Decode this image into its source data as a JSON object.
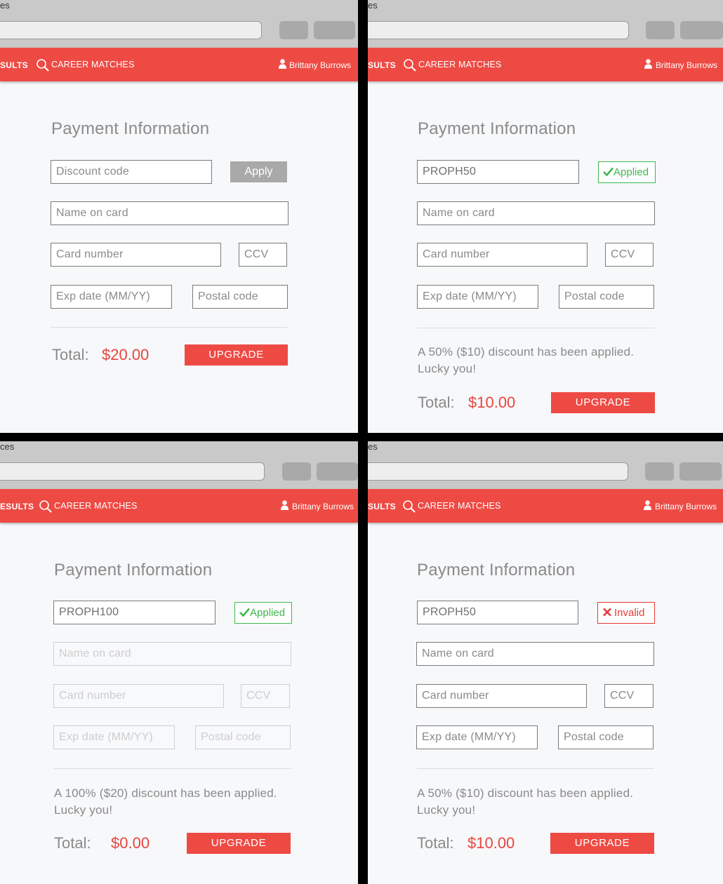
{
  "colors": {
    "accent": "#ee4a44",
    "success": "#3fb84d",
    "error": "#e53935",
    "price": "#e8453e"
  },
  "panels": [
    {
      "tab_fragment": "es",
      "nav": {
        "results": "SULTS",
        "career_matches": "CAREER MATCHES",
        "user": "Brittany Burrows"
      },
      "title": "Payment Information",
      "discount": {
        "placeholder": "Discount code",
        "value": "",
        "button": "Apply"
      },
      "name_on_card": "Name on card",
      "card_number": "Card number",
      "ccv": "CCV",
      "exp_date": "Exp date (MM/YY)",
      "postal_code": "Postal code",
      "message": "",
      "total_label": "Total:",
      "total_value": "$20.00",
      "upgrade": "UPGRADE"
    },
    {
      "tab_fragment": "es",
      "nav": {
        "results": "SULTS",
        "career_matches": "CAREER MATCHES",
        "user": "Brittany Burrows"
      },
      "title": "Payment Information",
      "discount": {
        "value": "PROPH50",
        "status": "Applied",
        "status_icon": "checkmark-icon"
      },
      "name_on_card": "Name on card",
      "card_number": "Card number",
      "ccv": "CCV",
      "exp_date": "Exp date (MM/YY)",
      "postal_code": "Postal code",
      "message_line1": "A 50% ($10) discount has been applied.",
      "message_line2": "Lucky you!",
      "total_label": "Total:",
      "total_value": "$10.00",
      "upgrade": "UPGRADE"
    },
    {
      "tab_fragment": "ces",
      "nav": {
        "results": "ESULTS",
        "career_matches": "CAREER MATCHES",
        "user": "Brittany Burrows"
      },
      "title": "Payment Information",
      "discount": {
        "value": "PROPH100",
        "status": "Applied",
        "status_icon": "checkmark-icon"
      },
      "name_on_card": "Name on card",
      "card_number": "Card number",
      "ccv": "CCV",
      "exp_date": "Exp date (MM/YY)",
      "postal_code": "Postal code",
      "message_line1": "A 100% ($20) discount has been applied.",
      "message_line2": "Lucky you!",
      "total_label": "Total:",
      "total_value": "$0.00",
      "upgrade": "UPGRADE"
    },
    {
      "tab_fragment": "es",
      "nav": {
        "results": "SULTS",
        "career_matches": "CAREER MATCHES",
        "user": "Brittany Burrows"
      },
      "title": "Payment Information",
      "discount": {
        "value": "PROPH50",
        "status": "Invalid",
        "status_icon": "x-icon"
      },
      "name_on_card": "Name on card",
      "card_number": "Card number",
      "ccv": "CCV",
      "exp_date": "Exp date (MM/YY)",
      "postal_code": "Postal code",
      "message_line1": "A 50% ($10) discount has been applied.",
      "message_line2": "Lucky you!",
      "total_label": "Total:",
      "total_value": "$10.00",
      "upgrade": "UPGRADE"
    }
  ]
}
